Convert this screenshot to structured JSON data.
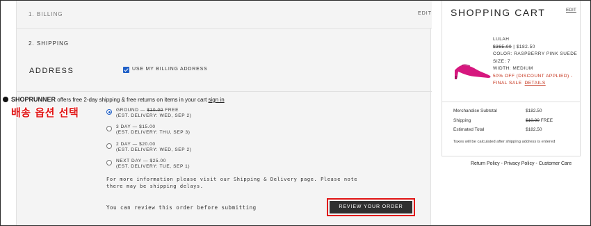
{
  "checkout": {
    "billing_step": "1. BILLING",
    "billing_edit": "EDIT",
    "shipping_step": "2. SHIPPING",
    "address_title": "ADDRESS",
    "use_billing_address": "USE MY BILLING ADDRESS",
    "use_billing_checked": true,
    "shoprunner": {
      "brand": "SHOPRUNNER",
      "text": " offers free 2-day shipping & free returns on items in your cart ",
      "link": "sign in"
    },
    "annotation": "배송 옵션 선택",
    "options": [
      {
        "line1_pre": "GROUND — ",
        "line1_strike": "$10.00",
        "line1_post": " FREE",
        "line2": "(EST. DELIVERY: WED, SEP 2)",
        "checked": true
      },
      {
        "line1_pre": "3 DAY — $15.00",
        "line1_strike": "",
        "line1_post": "",
        "line2": "(EST. DELIVERY: THU, SEP 3)",
        "checked": false
      },
      {
        "line1_pre": "2 DAY — $20.00",
        "line1_strike": "",
        "line1_post": "",
        "line2": "(EST. DELIVERY: WED, SEP 2)",
        "checked": false
      },
      {
        "line1_pre": "NEXT DAY — $25.00",
        "line1_strike": "",
        "line1_post": "",
        "line2": "(EST. DELIVERY: TUE, SEP 1)",
        "checked": false
      }
    ],
    "more_info_1": "For more information please visit our Shipping & Delivery page. Please note",
    "more_info_2": "there may be shipping delays.",
    "review_note": "You can review this order before submitting",
    "review_button": "REVIEW YOUR ORDER"
  },
  "cart": {
    "title": "SHOPPING CART",
    "edit": "EDIT",
    "item": {
      "name": "LULAH",
      "original_price": "$365.00",
      "price_sep": " | ",
      "price": "$182.50",
      "color": "COLOR: RASPBERRY PINK SUEDE",
      "size": "SIZE: 7",
      "width": "WIDTH: MEDIUM",
      "discount": "50% OFF (DISCOUNT APPLIED) -",
      "final_sale": "FINAL SALE",
      "details": "DETAILS"
    },
    "totals": {
      "subtotal_label": "Merchandise Subtotal",
      "subtotal_value": "$182.50",
      "shipping_label": "Shipping",
      "shipping_strike": "$10.00",
      "shipping_value": " FREE",
      "total_label": "Estimated Total",
      "total_value": "$182.50"
    },
    "tax_note": "Taxes will be calculated after shipping address is entered"
  },
  "footer": {
    "return_policy": "Return Policy",
    "sep": " - ",
    "privacy_policy": "Privacy Policy",
    "customer_care": "Customer Care"
  },
  "colors": {
    "accent_blue": "#1f5fc7",
    "annotation_red": "#e01414",
    "button_dark": "#2f2f2f",
    "sale_red": "#c32c14",
    "shoe_pink": "#d6177e"
  }
}
